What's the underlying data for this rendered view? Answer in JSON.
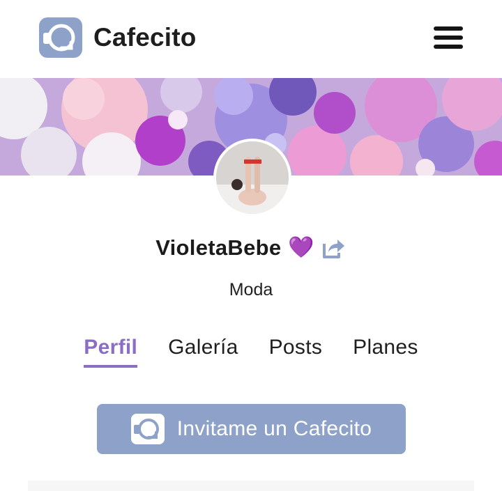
{
  "header": {
    "brand_name": "Cafecito",
    "logo_icon": "cafecito-cup-icon",
    "menu_icon": "hamburger-menu-icon"
  },
  "profile": {
    "username": "VioletaBebe",
    "emoji": "💜",
    "share_icon": "share-icon",
    "category": "Moda"
  },
  "tabs": [
    {
      "label": "Perfil",
      "active": true
    },
    {
      "label": "Galería",
      "active": false
    },
    {
      "label": "Posts",
      "active": false
    },
    {
      "label": "Planes",
      "active": false
    }
  ],
  "cta": {
    "label": "Invitame un Cafecito",
    "icon": "cafecito-cup-icon"
  },
  "colors": {
    "brand": "#8ea2c9",
    "accent": "#8a6ec1",
    "heart": "#9a3fd4"
  }
}
